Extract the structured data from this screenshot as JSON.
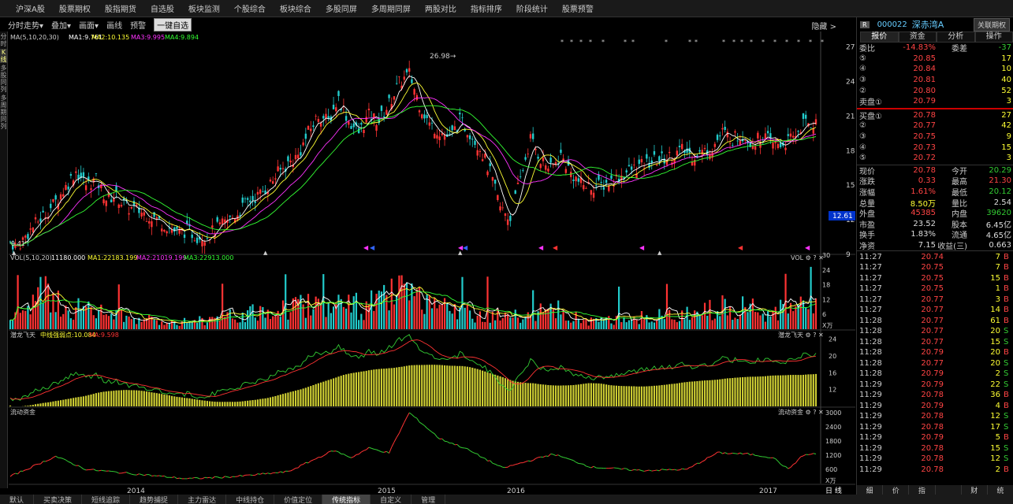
{
  "menu": [
    "沪深A股",
    "股票期权",
    "股指期货",
    "自选股",
    "板块监测",
    "个股综合",
    "板块综合",
    "多股同屏",
    "多周期同屏",
    "两股对比",
    "指标排序",
    "阶段统计",
    "股票预警"
  ],
  "toolbar": {
    "items": [
      "分时走势▾",
      "叠加▾",
      "画面▾",
      "画线",
      "预警"
    ],
    "selected": "一键自选",
    "hide": "隐藏 >"
  },
  "side_tabs": [
    "分时",
    "K线",
    "多股同列",
    "多周期同列"
  ],
  "ma_legend": {
    "label": "MA(5,10,20,30)",
    "ma1": "MA1:9.761",
    "ma2": "MA2:10.135",
    "ma3": "MA3:9.995",
    "ma4": "MA4:9.894"
  },
  "peak_label": "26.98",
  "low_label": "9.41",
  "price_axis": [
    "27",
    "24",
    "21",
    "18",
    "15",
    "12",
    "9"
  ],
  "current_price_tag": "12.61",
  "vol_legend": {
    "label": "VOL(5,10,20)",
    "v": "11180.000",
    "ma1": "MA1:22183.199",
    "ma2": "MA2:21019.199",
    "ma3": "MA3:22913.000",
    "title": "VOL"
  },
  "vol_axis": [
    "30",
    "24",
    "18",
    "12",
    "6",
    "X万"
  ],
  "qlft_legend": {
    "label": "潜龙飞天",
    "line": "中线强弱点:10.084",
    "ma": "MA:9.598",
    "title": "潜龙飞天"
  },
  "qlft_axis": [
    "24",
    "20",
    "16",
    "12"
  ],
  "ldzj_legend": {
    "label": "流动资金",
    "title": "流动资金"
  },
  "ldzj_axis": [
    "3000",
    "2400",
    "1800",
    "1200",
    "600",
    "X万"
  ],
  "years": [
    "2014",
    "2015",
    "2016",
    "2017"
  ],
  "period_btn": "日 线",
  "bottom_tabs": [
    "默认",
    "买卖决策",
    "短线追踪",
    "趋势捕捉",
    "主力雷达",
    "中线持仓",
    "价值定位",
    "传统指标",
    "自定义",
    "管理"
  ],
  "bottom_active": "传统指标",
  "right": {
    "r": "R",
    "code": "000022",
    "name": "深赤湾A",
    "btn": "关联期权",
    "tabs": [
      "报价",
      "资金",
      "分析",
      "操作"
    ],
    "weibi": {
      "l1": "委比",
      "v1": "-14.83%",
      "l2": "委差",
      "v2": "-37"
    },
    "sells": [
      {
        "n": "⑤",
        "p": "20.85",
        "v": "17"
      },
      {
        "n": "④",
        "p": "20.84",
        "v": "10"
      },
      {
        "n": "③",
        "p": "20.81",
        "v": "40"
      },
      {
        "n": "②",
        "p": "20.80",
        "v": "52"
      },
      {
        "n": "卖盘①",
        "p": "20.79",
        "v": "3"
      }
    ],
    "buys": [
      {
        "n": "买盘①",
        "p": "20.78",
        "v": "27"
      },
      {
        "n": "②",
        "p": "20.77",
        "v": "42"
      },
      {
        "n": "③",
        "p": "20.75",
        "v": "9"
      },
      {
        "n": "④",
        "p": "20.73",
        "v": "15"
      },
      {
        "n": "⑤",
        "p": "20.72",
        "v": "3"
      }
    ],
    "stats": [
      {
        "a": "现价",
        "b": "20.78",
        "bc": "red",
        "c": "今开",
        "d": "20.29",
        "dc": "green"
      },
      {
        "a": "涨跌",
        "b": "0.33",
        "bc": "red",
        "c": "最高",
        "d": "21.30",
        "dc": "red"
      },
      {
        "a": "涨幅",
        "b": "1.61%",
        "bc": "red",
        "c": "最低",
        "d": "20.12",
        "dc": "green"
      },
      {
        "a": "总量",
        "b": "8.50万",
        "bc": "yellow",
        "c": "量比",
        "d": "2.54",
        "dc": "white"
      },
      {
        "a": "外盘",
        "b": "45385",
        "bc": "red",
        "c": "内盘",
        "d": "39620",
        "dc": "green"
      },
      {
        "a": "市盈",
        "b": "23.52",
        "bc": "white",
        "c": "股本",
        "d": "6.45亿",
        "dc": "white"
      },
      {
        "a": "换手",
        "b": "1.83%",
        "bc": "white",
        "c": "流通",
        "d": "4.65亿",
        "dc": "white"
      },
      {
        "a": "净资",
        "b": "7.15",
        "bc": "white",
        "c": "收益(三)",
        "d": "0.663",
        "dc": "white"
      }
    ],
    "ticks": [
      {
        "t": "11:27",
        "p": "20.74",
        "v": "7",
        "f": "B"
      },
      {
        "t": "11:27",
        "p": "20.75",
        "v": "7",
        "f": "B"
      },
      {
        "t": "11:27",
        "p": "20.75",
        "v": "15",
        "f": "B"
      },
      {
        "t": "11:27",
        "p": "20.75",
        "v": "1",
        "f": "B"
      },
      {
        "t": "11:27",
        "p": "20.77",
        "v": "3",
        "f": "B"
      },
      {
        "t": "11:27",
        "p": "20.77",
        "v": "14",
        "f": "B"
      },
      {
        "t": "11:28",
        "p": "20.77",
        "v": "61",
        "f": "B"
      },
      {
        "t": "11:28",
        "p": "20.77",
        "v": "20",
        "f": "S"
      },
      {
        "t": "11:28",
        "p": "20.77",
        "v": "15",
        "f": "S"
      },
      {
        "t": "11:28",
        "p": "20.79",
        "v": "20",
        "f": "B"
      },
      {
        "t": "11:28",
        "p": "20.77",
        "v": "20",
        "f": "S"
      },
      {
        "t": "11:28",
        "p": "20.79",
        "v": "2",
        "f": "S"
      },
      {
        "t": "11:29",
        "p": "20.79",
        "v": "22",
        "f": "S"
      },
      {
        "t": "11:29",
        "p": "20.78",
        "v": "36",
        "f": "B"
      },
      {
        "t": "11:29",
        "p": "20.79",
        "v": "4",
        "f": "B"
      },
      {
        "t": "11:29",
        "p": "20.78",
        "v": "12",
        "f": "S"
      },
      {
        "t": "11:29",
        "p": "20.78",
        "v": "17",
        "f": "S"
      },
      {
        "t": "11:29",
        "p": "20.79",
        "v": "5",
        "f": "B"
      },
      {
        "t": "11:29",
        "p": "20.78",
        "v": "15",
        "f": "S"
      },
      {
        "t": "11:29",
        "p": "20.78",
        "v": "12",
        "f": "S"
      },
      {
        "t": "11:29",
        "p": "20.78",
        "v": "2",
        "f": "B"
      }
    ],
    "rbottom": [
      "细",
      "价",
      "指",
      "",
      "财",
      "统"
    ]
  },
  "chart_data": {
    "type": "candlestick",
    "price_ylim": [
      9,
      28
    ],
    "price_key": [
      [
        0,
        10.0
      ],
      [
        3,
        9.6
      ],
      [
        6,
        10.5
      ],
      [
        10,
        11.6
      ],
      [
        14,
        12.5
      ],
      [
        18,
        13.5
      ],
      [
        22,
        14.8
      ],
      [
        26,
        16.2
      ],
      [
        30,
        15.0
      ],
      [
        34,
        15.4
      ],
      [
        38,
        13.8
      ],
      [
        42,
        14.0
      ],
      [
        46,
        13.0
      ],
      [
        50,
        12.8
      ],
      [
        54,
        12.4
      ],
      [
        58,
        12.0
      ],
      [
        62,
        11.4
      ],
      [
        66,
        10.8
      ],
      [
        70,
        11.0
      ],
      [
        74,
        10.5
      ],
      [
        78,
        10.6
      ],
      [
        82,
        11.2
      ],
      [
        86,
        11.8
      ],
      [
        90,
        12.5
      ],
      [
        94,
        13.5
      ],
      [
        98,
        14.0
      ],
      [
        102,
        14.8
      ],
      [
        106,
        16.0
      ],
      [
        110,
        16.8
      ],
      [
        114,
        17.5
      ],
      [
        118,
        19.5
      ],
      [
        122,
        21.0
      ],
      [
        126,
        20.5
      ],
      [
        130,
        22.5
      ],
      [
        134,
        20.5
      ],
      [
        138,
        19.5
      ],
      [
        142,
        21.0
      ],
      [
        146,
        20.5
      ],
      [
        150,
        22.0
      ],
      [
        154,
        23.8
      ],
      [
        158,
        24.6
      ],
      [
        162,
        22.0
      ],
      [
        166,
        20.2
      ],
      [
        170,
        19.6
      ],
      [
        174,
        19.0
      ],
      [
        178,
        20.5
      ],
      [
        182,
        19.5
      ],
      [
        186,
        18.2
      ],
      [
        190,
        16.0
      ],
      [
        194,
        13.0
      ],
      [
        198,
        12.0
      ],
      [
        202,
        15.5
      ],
      [
        206,
        19.0
      ],
      [
        210,
        17.2
      ],
      [
        214,
        16.3
      ],
      [
        218,
        17.5
      ],
      [
        222,
        16.0
      ],
      [
        226,
        15.0
      ],
      [
        230,
        14.8
      ],
      [
        234,
        14.9
      ],
      [
        238,
        15.3
      ],
      [
        242,
        15.8
      ],
      [
        246,
        16.3
      ],
      [
        250,
        16.6
      ],
      [
        254,
        17.0
      ],
      [
        258,
        17.2
      ],
      [
        262,
        17.5
      ],
      [
        266,
        18.0
      ],
      [
        270,
        17.5
      ],
      [
        274,
        17.8
      ],
      [
        278,
        18.2
      ],
      [
        282,
        19.5
      ],
      [
        286,
        19.0
      ],
      [
        290,
        19.3
      ],
      [
        294,
        18.6
      ],
      [
        298,
        19.2
      ],
      [
        302,
        18.5
      ],
      [
        306,
        18.5
      ],
      [
        310,
        19.0
      ],
      [
        314,
        20.3
      ],
      [
        318,
        20.3
      ]
    ],
    "vol_key": [
      [
        0,
        4
      ],
      [
        12,
        14
      ],
      [
        24,
        9
      ],
      [
        40,
        6
      ],
      [
        60,
        3
      ],
      [
        80,
        4
      ],
      [
        100,
        7
      ],
      [
        120,
        11
      ],
      [
        140,
        9
      ],
      [
        155,
        15
      ],
      [
        165,
        9
      ],
      [
        180,
        7
      ],
      [
        200,
        5
      ],
      [
        215,
        8
      ],
      [
        230,
        3
      ],
      [
        250,
        5
      ],
      [
        270,
        6
      ],
      [
        282,
        10
      ],
      [
        300,
        7
      ],
      [
        318,
        9
      ]
    ],
    "vol_ylim": [
      0,
      30
    ],
    "qlft_ylim": [
      8,
      26
    ],
    "ldzj_key": [
      [
        0,
        300
      ],
      [
        18,
        1150
      ],
      [
        30,
        600
      ],
      [
        50,
        400
      ],
      [
        70,
        200
      ],
      [
        90,
        300
      ],
      [
        110,
        500
      ],
      [
        128,
        1400
      ],
      [
        135,
        1100
      ],
      [
        142,
        1500
      ],
      [
        150,
        1300
      ],
      [
        158,
        3000
      ],
      [
        170,
        1900
      ],
      [
        180,
        1500
      ],
      [
        195,
        650
      ],
      [
        215,
        1250
      ],
      [
        230,
        700
      ],
      [
        250,
        550
      ],
      [
        268,
        600
      ],
      [
        280,
        1300
      ],
      [
        292,
        1250
      ],
      [
        302,
        1100
      ],
      [
        308,
        600
      ],
      [
        314,
        1200
      ],
      [
        318,
        1250
      ]
    ],
    "ldzj_ylim": [
      0,
      3200
    ]
  }
}
